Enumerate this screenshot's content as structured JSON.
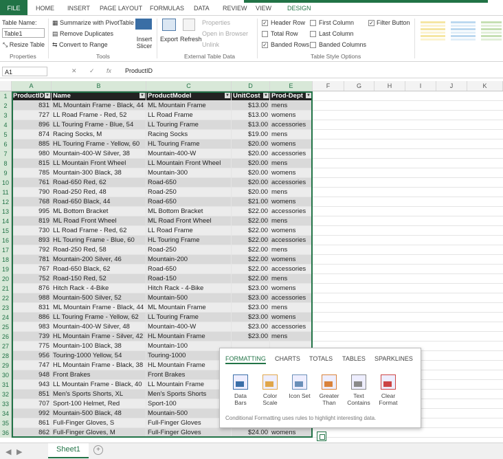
{
  "ribbon_tabs": [
    "FILE",
    "HOME",
    "INSERT",
    "PAGE LAYOUT",
    "FORMULAS",
    "DATA",
    "REVIEW",
    "VIEW",
    "DESIGN"
  ],
  "properties": {
    "table_name_label": "Table Name:",
    "table_name_value": "Table1",
    "resize_label": "Resize Table",
    "group": "Properties"
  },
  "tools": {
    "summarize": "Summarize with PivotTable",
    "remove_dup": "Remove Duplicates",
    "convert": "Convert to Range",
    "slicer": "Insert Slicer",
    "group": "Tools"
  },
  "external": {
    "export": "Export",
    "refresh": "Refresh",
    "properties": "Properties",
    "open_browser": "Open in Browser",
    "unlink": "Unlink",
    "group": "External Table Data"
  },
  "style_options": {
    "header_row": "Header Row",
    "total_row": "Total Row",
    "banded_rows": "Banded Rows",
    "first_column": "First Column",
    "last_column": "Last Column",
    "banded_columns": "Banded Columns",
    "filter_button": "Filter Button",
    "group": "Table Style Options",
    "header_row_checked": true,
    "total_row_checked": false,
    "banded_rows_checked": true,
    "first_column_checked": false,
    "last_column_checked": false,
    "banded_columns_checked": false,
    "filter_button_checked": true
  },
  "formula_bar": {
    "cell_ref": "A1",
    "formula": "ProductID"
  },
  "column_letters": [
    "A",
    "B",
    "C",
    "D",
    "E",
    "F",
    "G",
    "H",
    "I",
    "J",
    "K"
  ],
  "table": {
    "headers": [
      "ProductID",
      "Name",
      "ProductModel",
      "UnitCost",
      "Prod-Dept"
    ],
    "rows": [
      [
        "831",
        "ML Mountain Frame - Black, 44",
        "ML Mountain Frame",
        "$13.00",
        "mens"
      ],
      [
        "727",
        "LL Road Frame - Red, 52",
        "LL Road Frame",
        "$13.00",
        "womens"
      ],
      [
        "896",
        "LL Touring Frame - Blue, 54",
        "LL Touring Frame",
        "$13.00",
        "accessories"
      ],
      [
        "874",
        "Racing Socks, M",
        "Racing Socks",
        "$19.00",
        "mens"
      ],
      [
        "885",
        "HL Touring Frame - Yellow, 60",
        "HL Touring Frame",
        "$20.00",
        "womens"
      ],
      [
        "980",
        "Mountain-400-W Silver, 38",
        "Mountain-400-W",
        "$20.00",
        "accessories"
      ],
      [
        "815",
        "LL Mountain Front Wheel",
        "LL Mountain Front Wheel",
        "$20.00",
        "mens"
      ],
      [
        "785",
        "Mountain-300 Black, 38",
        "Mountain-300",
        "$20.00",
        "womens"
      ],
      [
        "761",
        "Road-650 Red, 62",
        "Road-650",
        "$20.00",
        "accessories"
      ],
      [
        "790",
        "Road-250 Red, 48",
        "Road-250",
        "$20.00",
        "mens"
      ],
      [
        "768",
        "Road-650 Black, 44",
        "Road-650",
        "$21.00",
        "womens"
      ],
      [
        "995",
        "ML Bottom Bracket",
        "ML Bottom Bracket",
        "$22.00",
        "accessories"
      ],
      [
        "819",
        "ML Road Front Wheel",
        "ML Road Front Wheel",
        "$22.00",
        "mens"
      ],
      [
        "730",
        "LL Road Frame - Red, 62",
        "LL Road Frame",
        "$22.00",
        "womens"
      ],
      [
        "893",
        "HL Touring Frame - Blue, 60",
        "HL Touring Frame",
        "$22.00",
        "accessories"
      ],
      [
        "792",
        "Road-250 Red, 58",
        "Road-250",
        "$22.00",
        "mens"
      ],
      [
        "781",
        "Mountain-200 Silver, 46",
        "Mountain-200",
        "$22.00",
        "womens"
      ],
      [
        "767",
        "Road-650 Black, 62",
        "Road-650",
        "$22.00",
        "accessories"
      ],
      [
        "752",
        "Road-150 Red, 52",
        "Road-150",
        "$22.00",
        "mens"
      ],
      [
        "876",
        "Hitch Rack - 4-Bike",
        "Hitch Rack - 4-Bike",
        "$23.00",
        "womens"
      ],
      [
        "988",
        "Mountain-500 Silver, 52",
        "Mountain-500",
        "$23.00",
        "accessories"
      ],
      [
        "831",
        "ML Mountain Frame - Black, 44",
        "ML Mountain Frame",
        "$23.00",
        "mens"
      ],
      [
        "886",
        "LL Touring Frame - Yellow, 62",
        "LL Touring Frame",
        "$23.00",
        "womens"
      ],
      [
        "983",
        "Mountain-400-W Silver, 48",
        "Mountain-400-W",
        "$23.00",
        "accessories"
      ],
      [
        "739",
        "HL Mountain Frame - Silver, 42",
        "HL Mountain Frame",
        "$23.00",
        "mens"
      ],
      [
        "775",
        "Mountain-100 Black, 38",
        "Mountain-100",
        "",
        ""
      ],
      [
        "956",
        "Touring-1000 Yellow, 54",
        "Touring-1000",
        "",
        ""
      ],
      [
        "747",
        "HL Mountain Frame - Black, 38",
        "HL Mountain Frame",
        "",
        ""
      ],
      [
        "948",
        "Front Brakes",
        "Front Brakes",
        "",
        ""
      ],
      [
        "943",
        "LL Mountain Frame - Black, 40",
        "LL Mountain Frame",
        "",
        ""
      ],
      [
        "851",
        "Men's Sports Shorts, XL",
        "Men's Sports Shorts",
        "",
        ""
      ],
      [
        "707",
        "Sport-100 Helmet, Red",
        "Sport-100",
        "",
        ""
      ],
      [
        "992",
        "Mountain-500 Black, 48",
        "Mountain-500",
        "",
        ""
      ],
      [
        "861",
        "Full-Finger Gloves, S",
        "Full-Finger Gloves",
        "",
        ""
      ],
      [
        "862",
        "Full-Finger Gloves, M",
        "Full-Finger Gloves",
        "$24.00",
        "womens"
      ]
    ]
  },
  "quick_analysis": {
    "tabs": [
      "FORMATTING",
      "CHARTS",
      "TOTALS",
      "TABLES",
      "SPARKLINES"
    ],
    "options": [
      [
        "Data",
        "Bars"
      ],
      [
        "Color",
        "Scale"
      ],
      [
        "Icon Set",
        ""
      ],
      [
        "Greater",
        "Than"
      ],
      [
        "Text",
        "Contains"
      ],
      [
        "Clear",
        "Format"
      ]
    ],
    "description": "Conditional Formatting uses rules to highlight interesting data."
  },
  "sheet_tab": "Sheet1",
  "colors": {
    "accent": "#217346",
    "header_bg": "#222222",
    "band_dark": "#d9d9d9",
    "band_light": "#ececec"
  }
}
